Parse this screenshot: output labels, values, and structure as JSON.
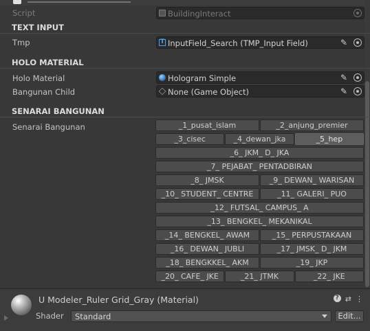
{
  "script": {
    "label": "Script",
    "value": "BuildingInteract",
    "icon": "script-icon"
  },
  "sections": {
    "text_input": "TEXT INPUT",
    "holo_material": "HOLO MATERIAL",
    "senarai_bangunan": "SENARAI BANGUNAN"
  },
  "tmp": {
    "label": "Tmp",
    "value": "InputField_Search (TMP_Input Field)",
    "icon": "text-input-icon"
  },
  "holo": {
    "label": "Holo Material",
    "value": "Hologram Simple",
    "icon": "material-icon"
  },
  "bangunan_child": {
    "label": "Bangunan Child",
    "value": "None (Game Object)",
    "icon": "gameobject-icon"
  },
  "senarai": {
    "label": "Senarai Bangunan",
    "rows": [
      [
        "_1_pusat_islam",
        "_2_anjung_premier"
      ],
      [
        "_3_cisec",
        "_4_dewan_jka",
        "_5_hep"
      ],
      [
        "_6_ JKM_ D_ JKA"
      ],
      [
        "_7_ PEJABAT_ PENTADBIRAN"
      ],
      [
        "_8_ JMSK",
        "_9_ DEWAN_ WARISAN"
      ],
      [
        "_10_ STUDENT_ CENTRE",
        "_11_ GALERI_ PUO"
      ],
      [
        "_12_ FUTSAL_ CAMPUS_ A"
      ],
      [
        "_13_ BENGKEL_ MEKANIKAL"
      ],
      [
        "_14_ BENGKEL_ AWAM",
        "_15_ PERPUSTAKAAN"
      ],
      [
        "_16_ DEWAN_ JUBLI",
        "_17_ JMSK_ D_ JKM"
      ],
      [
        "_18_ BENGKKEL_ AKM",
        "_19_ JKP"
      ],
      [
        "_20_ CAFE_ JKE",
        "_21_ JTMK",
        "_22_ JKE"
      ]
    ],
    "active": "_5_hep"
  },
  "material": {
    "title": "U Modeler_Ruler Grid_Gray (Material)",
    "shader_label": "Shader",
    "shader_value": "Standard",
    "edit_label": "Edit..."
  },
  "colors": {
    "background": "#383838",
    "field": "#2a2a2a",
    "button": "#4c4c4c",
    "accent": "#4aa3ff"
  }
}
